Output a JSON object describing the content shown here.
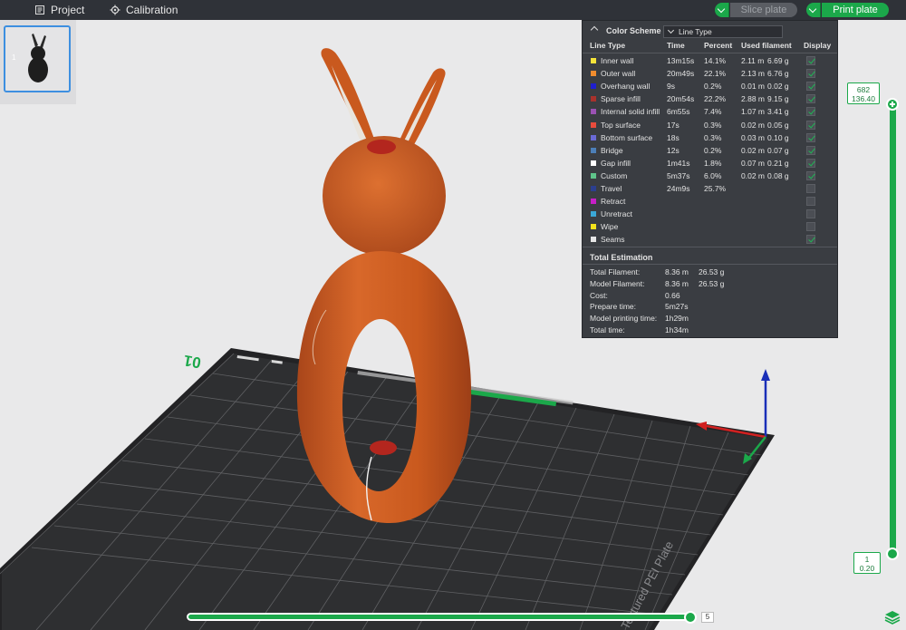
{
  "toolbar": {
    "project_label": "Project",
    "calibration_label": "Calibration",
    "slice_label": "Slice plate",
    "print_label": "Print plate"
  },
  "thumbnail": {
    "plate_number": "1"
  },
  "plate": {
    "number_label": "01",
    "brand_text": "Textured PEI Plate"
  },
  "legend": {
    "color_scheme_label": "Color Scheme",
    "color_scheme_value": "Line Type",
    "columns": [
      "Line Type",
      "Time",
      "Percent",
      "Used filament",
      "Display"
    ],
    "rows": [
      {
        "name": "Inner wall",
        "color": "#f4e33a",
        "time": "13m15s",
        "percent": "14.1%",
        "length": "2.11 m",
        "weight": "6.69 g",
        "display": true
      },
      {
        "name": "Outer wall",
        "color": "#f08c2e",
        "time": "20m49s",
        "percent": "22.1%",
        "length": "2.13 m",
        "weight": "6.76 g",
        "display": true
      },
      {
        "name": "Overhang wall",
        "color": "#1f1fcf",
        "time": "9s",
        "percent": "0.2%",
        "length": "0.01 m",
        "weight": "0.02 g",
        "display": true
      },
      {
        "name": "Sparse infill",
        "color": "#a8322c",
        "time": "20m54s",
        "percent": "22.2%",
        "length": "2.88 m",
        "weight": "9.15 g",
        "display": true
      },
      {
        "name": "Internal solid infill",
        "color": "#9b52b4",
        "time": "6m55s",
        "percent": "7.4%",
        "length": "1.07 m",
        "weight": "3.41 g",
        "display": true
      },
      {
        "name": "Top surface",
        "color": "#e84b3c",
        "time": "17s",
        "percent": "0.3%",
        "length": "0.02 m",
        "weight": "0.05 g",
        "display": true
      },
      {
        "name": "Bottom surface",
        "color": "#6a6ad6",
        "time": "18s",
        "percent": "0.3%",
        "length": "0.03 m",
        "weight": "0.10 g",
        "display": true
      },
      {
        "name": "Bridge",
        "color": "#4c7fb8",
        "time": "12s",
        "percent": "0.2%",
        "length": "0.02 m",
        "weight": "0.07 g",
        "display": true
      },
      {
        "name": "Gap infill",
        "color": "#ffffff",
        "time": "1m41s",
        "percent": "1.8%",
        "length": "0.07 m",
        "weight": "0.21 g",
        "display": true
      },
      {
        "name": "Custom",
        "color": "#5fc48a",
        "time": "5m37s",
        "percent": "6.0%",
        "length": "0.02 m",
        "weight": "0.08 g",
        "display": true
      },
      {
        "name": "Travel",
        "color": "#2c3f8f",
        "time": "24m9s",
        "percent": "25.7%",
        "length": "",
        "weight": "",
        "display": false
      },
      {
        "name": "Retract",
        "color": "#c71fc7",
        "time": "",
        "percent": "",
        "length": "",
        "weight": "",
        "display": false
      },
      {
        "name": "Unretract",
        "color": "#3aa7d6",
        "time": "",
        "percent": "",
        "length": "",
        "weight": "",
        "display": false
      },
      {
        "name": "Wipe",
        "color": "#f2e21c",
        "time": "",
        "percent": "",
        "length": "",
        "weight": "",
        "display": false
      },
      {
        "name": "Seams",
        "color": "#e6e6e6",
        "time": "",
        "percent": "",
        "length": "",
        "weight": "",
        "display": true
      }
    ],
    "total_title": "Total Estimation",
    "totals": [
      {
        "label": "Total Filament:",
        "v1": "8.36 m",
        "v2": "26.53 g"
      },
      {
        "label": "Model Filament:",
        "v1": "8.36 m",
        "v2": "26.53 g"
      },
      {
        "label": "Cost:",
        "v1": "0.66",
        "v2": ""
      },
      {
        "label": "Prepare time:",
        "v1": "5m27s",
        "v2": ""
      },
      {
        "label": "Model printing time:",
        "v1": "1h29m",
        "v2": ""
      },
      {
        "label": "Total time:",
        "v1": "1h34m",
        "v2": ""
      }
    ]
  },
  "layer_slider": {
    "top_layer": "682",
    "top_height": "136.40",
    "bottom_layer": "1",
    "bottom_height": "0.20"
  },
  "move_slider": {
    "value": "5",
    "fill_fraction": 1.0
  },
  "colors": {
    "accent": "#1ba84a",
    "model": "#c9591e",
    "bed": "#2b2b2d"
  }
}
